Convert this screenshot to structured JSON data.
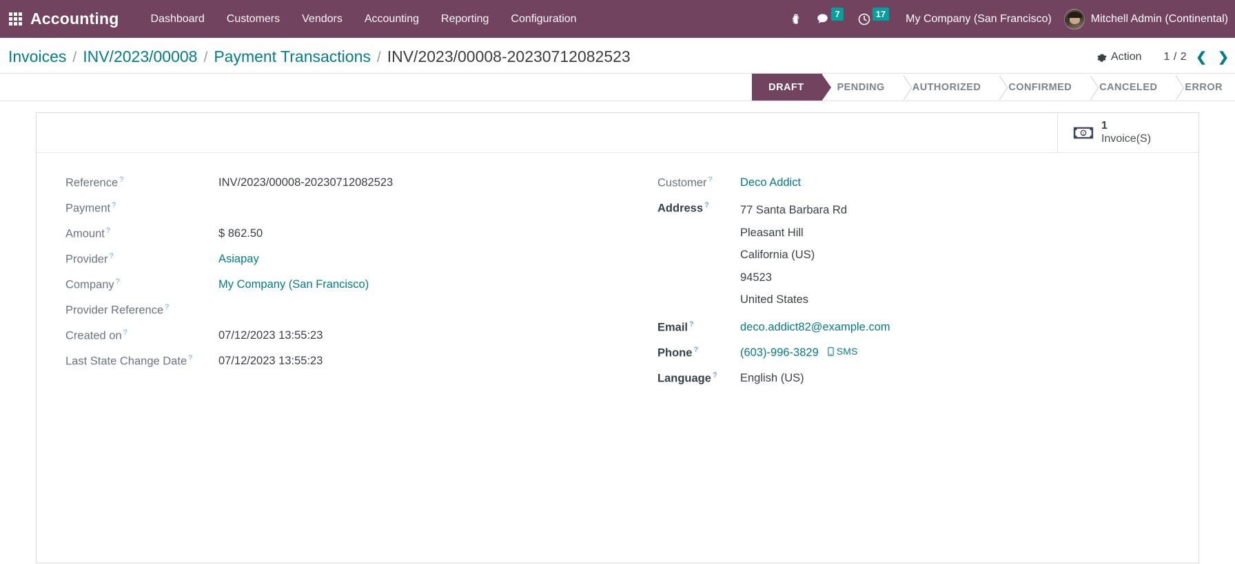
{
  "navbar": {
    "apps_icon": "apps-grid-icon",
    "brand": "Accounting",
    "menu_items": [
      {
        "label": "Dashboard"
      },
      {
        "label": "Customers"
      },
      {
        "label": "Vendors"
      },
      {
        "label": "Accounting"
      },
      {
        "label": "Reporting"
      },
      {
        "label": "Configuration"
      }
    ],
    "debug_icon": "bug-icon",
    "messages_icon": "chat-bubble-icon",
    "messages_count": "7",
    "activities_icon": "clock-icon",
    "activities_count": "17",
    "company": "My Company (San Francisco)",
    "user_name": "Mitchell Admin (Continental)",
    "avatar": "user-avatar",
    "accent_color": "#71435f",
    "badge_color": "#00a09d"
  },
  "breadcrumb": {
    "items": [
      {
        "label": "Invoices",
        "type": "link"
      },
      {
        "label": "INV/2023/00008",
        "type": "link"
      },
      {
        "label": "Payment Transactions",
        "type": "link"
      },
      {
        "label": "INV/2023/00008-20230712082523",
        "type": "current"
      }
    ],
    "separator": "/"
  },
  "control_panel": {
    "action_icon": "gear-icon",
    "action_label": "Action",
    "pager_value": "1 / 2",
    "pager_prev_icon": "chevron-left-icon",
    "pager_next_icon": "chevron-right-icon"
  },
  "statusbar": {
    "active": "DRAFT",
    "stages": [
      {
        "label": "DRAFT"
      },
      {
        "label": "PENDING"
      },
      {
        "label": "AUTHORIZED"
      },
      {
        "label": "CONFIRMED"
      },
      {
        "label": "CANCELED"
      },
      {
        "label": "ERROR"
      }
    ]
  },
  "smart_button": {
    "icon": "money-bill-icon",
    "value": "1",
    "label": "Invoice(S)"
  },
  "form": {
    "left": [
      {
        "label": "Reference",
        "tip": "?",
        "value": "INV/2023/00008-20230712082523",
        "kind": "text"
      },
      {
        "label": "Payment",
        "tip": "?",
        "value": "",
        "kind": "empty"
      },
      {
        "label": "Amount",
        "tip": "?",
        "value": "$ 862.50",
        "kind": "text"
      },
      {
        "label": "Provider",
        "tip": "?",
        "value": "Asiapay",
        "kind": "link"
      },
      {
        "label": "Company",
        "tip": "?",
        "value": "My Company (San Francisco)",
        "kind": "link"
      },
      {
        "label": "Provider Reference",
        "tip": "?",
        "value": "",
        "kind": "empty"
      },
      {
        "label": "Created on",
        "tip": "?",
        "value": "07/12/2023 13:55:23",
        "kind": "text"
      },
      {
        "label": "Last State Change Date",
        "tip": "?",
        "value": "07/12/2023 13:55:23",
        "kind": "text"
      }
    ],
    "right": {
      "customer_label": "Customer",
      "customer_tip": "?",
      "customer_value": "Deco Addict",
      "address_label": "Address",
      "address_tip": "?",
      "address_lines": [
        "77 Santa Barbara Rd",
        "Pleasant Hill",
        "California (US)",
        "94523",
        "United States"
      ],
      "email_label": "Email",
      "email_tip": "?",
      "email_value": "deco.addict82@example.com",
      "phone_label": "Phone",
      "phone_tip": "?",
      "phone_value": "(603)-996-3829",
      "sms_icon": "mobile-phone-icon",
      "sms_label": "SMS",
      "language_label": "Language",
      "language_tip": "?",
      "language_value": "English (US)"
    }
  }
}
